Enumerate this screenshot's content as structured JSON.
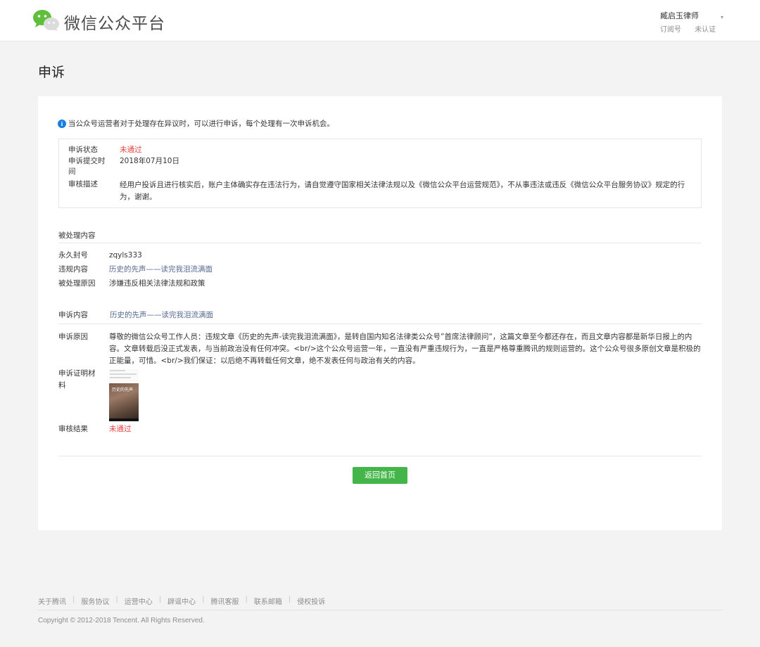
{
  "header": {
    "brand": "微信公众平台",
    "account_name": "臧启玉律师",
    "account_type": "订阅号",
    "account_verify": "未认证"
  },
  "page": {
    "title": "申诉"
  },
  "notice": "当公众号运营者对于处理存在异议时，可以进行申诉，每个处理有一次申诉机会。",
  "status": {
    "state_label": "申诉状态",
    "state_value": "未通过",
    "date_label": "申诉提交时间",
    "date_value": "2018年07月10日",
    "desc_label": "审核描述",
    "desc_value": "经用户投诉且进行核实后，账户主体确实存在违法行为，请自觉遵守国家相关法律法规以及《微信公众平台运营规范》，不从事违法或违反《微信公众平台服务协议》规定的行为，谢谢。"
  },
  "handled": {
    "section_title": "被处理内容",
    "ban_label": "永久封号",
    "ban_value": "zqyls333",
    "content_label": "违规内容",
    "content_value": "历史的先声——读完我泪流满面",
    "reason_label": "被处理原因",
    "reason_value": "涉嫌违反相关法律法规和政策"
  },
  "appeal": {
    "section_label": "申诉内容",
    "section_link": "历史的先声——读完我泪流满面",
    "reason_label": "申诉原因",
    "reason_value": "尊敬的微信公众号工作人员：违规文章《历史的先声-读完我泪流满面》，是转自国内知名法律类公众号”首席法律顾问“，这篇文章至今都还存在，而且文章内容都是新华日报上的内容。文章转载后没正式发表，与当前政治没有任何冲突。<br/>这个公众号运营一年，一直没有严重违规行为，一直是严格尊重腾讯的规则运营的。这个公众号很多原创文章是积极的正能量，可惜。<br/>我们保证：以后绝不再转载任何文章，绝不发表任何与政治有关的内容。",
    "evidence_label": "申诉证明材料",
    "evidence_book_title": "历史的先声",
    "result_label": "审核结果",
    "result_value": "未通过"
  },
  "actions": {
    "return_label": "返回首页"
  },
  "footer": {
    "links": [
      "关于腾讯",
      "服务协议",
      "运营中心",
      "辟谣中心",
      "腾讯客服",
      "联系邮箱",
      "侵权投诉"
    ],
    "copyright": "Copyright © 2012-2018 Tencent. All Rights Reserved."
  },
  "colors": {
    "accent_green": "#44b549",
    "error_red": "#e64340",
    "link_blue": "#576b95",
    "info_blue": "#1a7ee0"
  },
  "icons": [
    "wechat-logo-icon",
    "chevron-down-icon",
    "info-icon"
  ]
}
